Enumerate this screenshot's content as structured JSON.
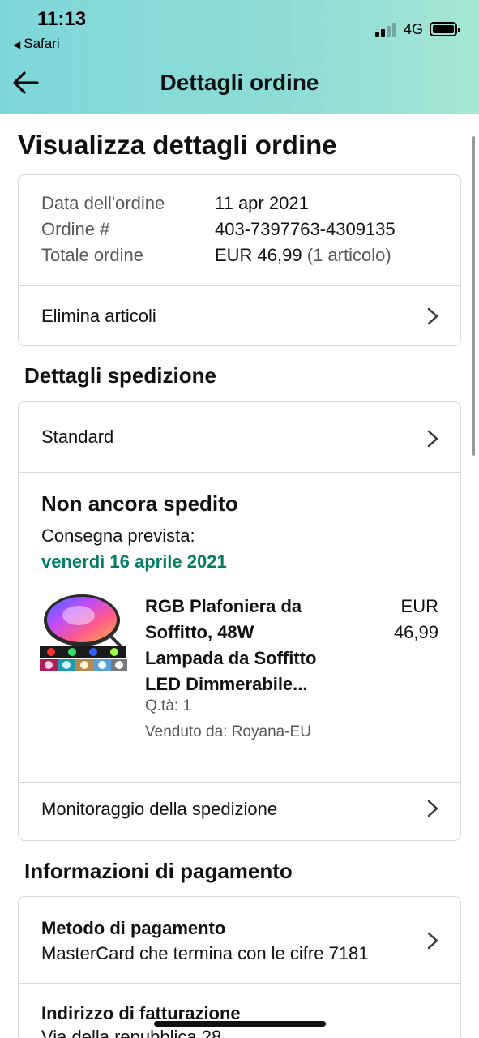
{
  "status_bar": {
    "time": "11:13",
    "back_app": "Safari",
    "network": "4G"
  },
  "nav": {
    "title": "Dettagli ordine",
    "back_icon": "arrow-left-icon"
  },
  "page": {
    "title": "Visualizza dettagli ordine"
  },
  "order_summary": {
    "date_label": "Data dell'ordine",
    "date_value": "11 apr 2021",
    "order_label": "Ordine #",
    "order_value": "403-7397763-4309135",
    "total_label": "Totale ordine",
    "total_value": "EUR 46,99",
    "total_count": "(1 articolo)",
    "delete_items": "Elimina articoli"
  },
  "shipping": {
    "section_title": "Dettagli spedizione",
    "method": "Standard",
    "status": "Non ancora spedito",
    "eta_label": "Consegna prevista:",
    "eta_date": "venerdì 16 aprile 2021",
    "product": {
      "name_lines": [
        "RGB Plafoniera da",
        "Soffitto, 48W",
        "Lampada da Soffitto",
        "LED Dimmerabile..."
      ],
      "price_lines": [
        "EUR",
        "46,99"
      ],
      "qty": "Q.tà: 1",
      "seller": "Venduto da: Royana-EU"
    },
    "tracking": "Monitoraggio della spedizione"
  },
  "payment": {
    "section_title": "Informazioni di pagamento",
    "method_title": "Metodo di pagamento",
    "method_value": "MasterCard che termina con le cifre 7181",
    "billing_title": "Indirizzo di fatturazione",
    "billing_value": "Via della repubblica 28"
  },
  "colors": {
    "header_gradient_start": "#7fd6d8",
    "header_gradient_end": "#a6e6d4",
    "eta_green": "#067d62",
    "border": "#d5d9d9"
  }
}
